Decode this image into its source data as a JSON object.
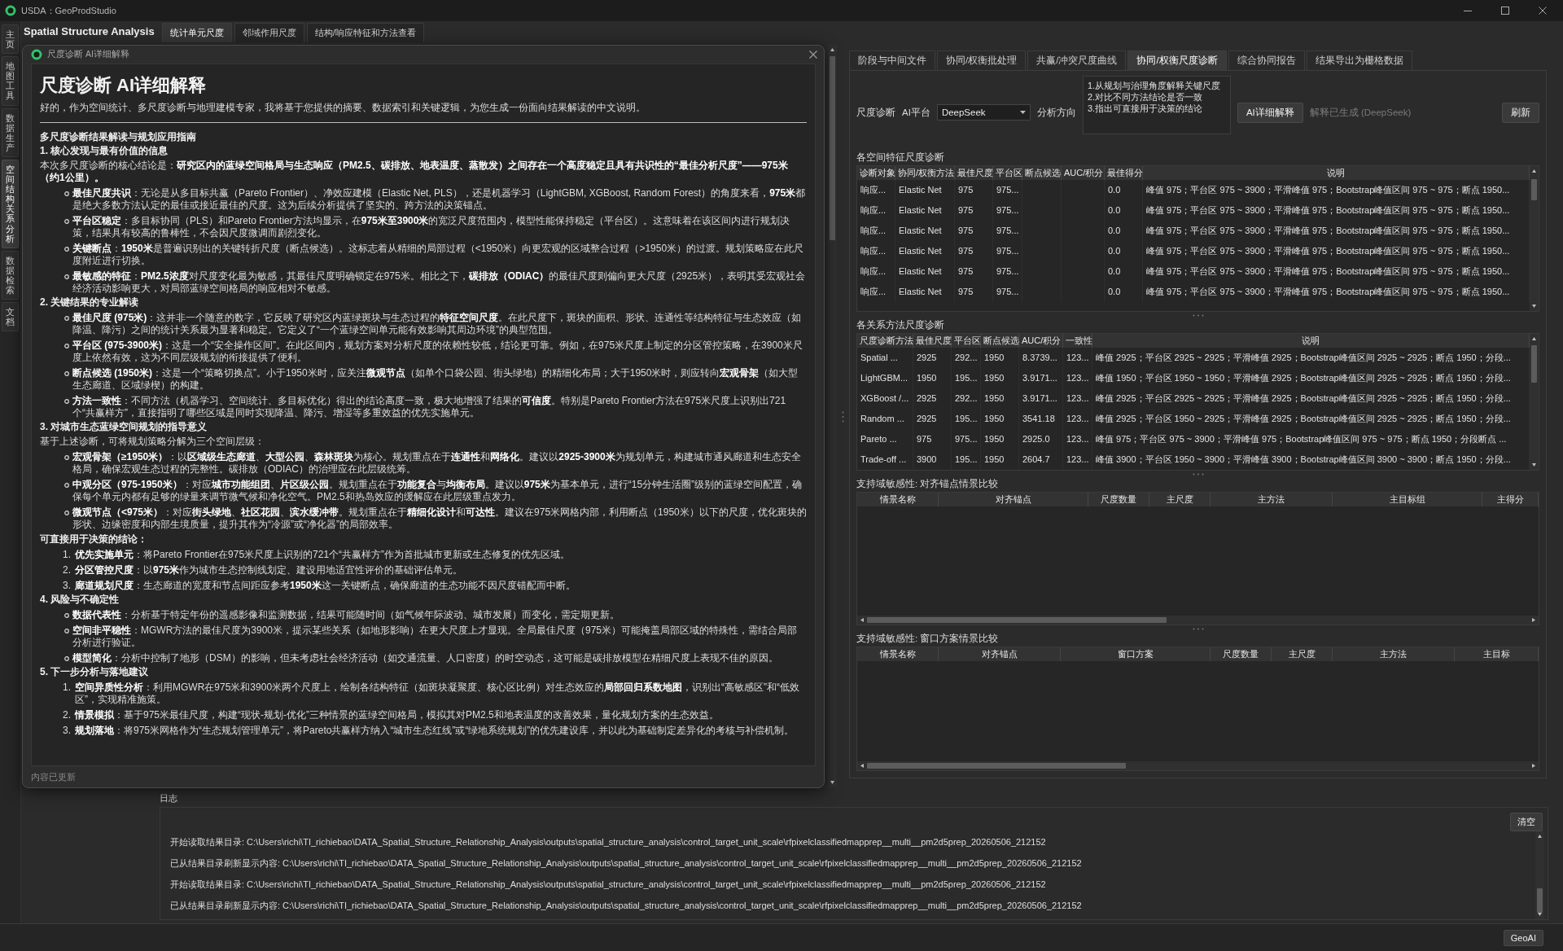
{
  "window": {
    "title": "USDA：GeoProdStudio"
  },
  "side_tabs": [
    {
      "label": "主页",
      "selected": false
    },
    {
      "label": "地图工具",
      "selected": false
    },
    {
      "label": "数据生产",
      "selected": false
    },
    {
      "label": "空间结构关系分析",
      "selected": true
    },
    {
      "label": "数据检索",
      "selected": false
    },
    {
      "label": "文档",
      "selected": false
    }
  ],
  "module": {
    "title": "Spatial Structure Analysis",
    "tabs": [
      {
        "label": "统计单元尺度",
        "selected": true
      },
      {
        "label": "邻域作用尺度",
        "selected": false
      },
      {
        "label": "结构/响应特征和方法查看",
        "selected": false
      }
    ]
  },
  "dialog": {
    "title": "尺度诊断 AI详细解释",
    "heading": "尺度诊断 AI详细解释",
    "intro": "好的，作为空间统计、多尺度诊断与地理建模专家，我将基于您提供的摘要、数据索引和关键逻辑，为您生成一份面向结果解读的中文说明。",
    "document": {
      "title": "多尺度诊断结果解读与规划应用指南",
      "sections": [
        {
          "heading": "1. 核心发现与最有价值的信息",
          "blocks": [
            {
              "kind": "paragraph",
              "text": "本次多尺度诊断的核心结论是：**研究区内的蓝绿空间格局与生态响应（PM2.5、碳排放、地表温度、蒸散发）之间存在一个高度稳定且具有共识性的“最佳分析尺度”——975米（约1公里）。**"
            },
            {
              "kind": "bullets",
              "items": [
                "**最佳尺度共识**：无论是从多目标共赢（Pareto Frontier）、净效应建模（Elastic Net, PLS），还是机器学习（LightGBM, XGBoost, Random Forest）的角度来看，**975米**都是绝大多数方法认定的最佳或接近最佳的尺度。这为后续分析提供了坚实的、跨方法的决策锚点。",
                "**平台区稳定**：多目标协同（PLS）和Pareto Frontier方法均显示，在**975米至3900米**的宽泛尺度范围内，模型性能保持稳定（平台区）。这意味着在该区间内进行规划决策，结果具有较高的鲁棒性，不会因尺度微调而剧烈变化。",
                "**关键断点**：**1950米**是普遍识别出的关键转折尺度（断点候选）。这标志着从精细的局部过程（<1950米）向更宏观的区域整合过程（>1950米）的过渡。规划策略应在此尺度附近进行切换。",
                "**最敏感的特征**：**PM2.5浓度**对尺度变化最为敏感，其最佳尺度明确锁定在975米。相比之下，**碳排放（ODIAC）**的最佳尺度则偏向更大尺度（2925米），表明其受宏观社会经济活动影响更大，对局部蓝绿空间格局的响应相对不敏感。"
              ]
            }
          ]
        },
        {
          "heading": "2. 关键结果的专业解读",
          "blocks": [
            {
              "kind": "bullets",
              "items": [
                "**最佳尺度 (975米)**：这并非一个随意的数字，它反映了研究区内蓝绿斑块与生态过程的**特征空间尺度**。在此尺度下，斑块的面积、形状、连通性等结构特征与生态效应（如降温、降污）之间的统计关系最为显著和稳定。它定义了“一个蓝绿空间单元能有效影响其周边环境”的典型范围。",
                "**平台区 (975-3900米)**：这是一个“安全操作区间”。在此区间内，规划方案对分析尺度的依赖性较低，结论更可靠。例如，在975米尺度上制定的分区管控策略，在3900米尺度上依然有效，这为不同层级规划的衔接提供了便利。",
                "**断点候选 (1950米)**：这是一个“策略切换点”。小于1950米时，应关注**微观节点**（如单个口袋公园、街头绿地）的精细化布局；大于1950米时，则应转向**宏观骨架**（如大型生态廊道、区域绿楔）的构建。",
                "**方法一致性**：不同方法（机器学习、空间统计、多目标优化）得出的结论高度一致，极大地增强了结果的**可信度**。特别是Pareto Frontier方法在975米尺度上识别出721个“共赢样方”，直接指明了哪些区域是同时实现降温、降污、增湿等多重效益的优先实施单元。"
              ]
            }
          ]
        },
        {
          "heading": "3. 对城市生态蓝绿空间规划的指导意义",
          "blocks": [
            {
              "kind": "paragraph",
              "text": "基于上述诊断，可将规划策略分解为三个空间层级："
            },
            {
              "kind": "bullets",
              "items": [
                "**宏观骨架（≥1950米）**：以**区域级生态廊道**、**大型公园**、**森林斑块**为核心。规划重点在于**连通性**和**网络化**。建议以**2925-3900米**为规划单元，构建城市通风廊道和生态安全格局，确保宏观生态过程的完整性。碳排放（ODIAC）的治理应在此层级统筹。",
                "**中观分区（975-1950米）**：对应**城市功能组团**、**片区级公园**。规划重点在于**功能复合**与**均衡布局**。建议以**975米**为基本单元，进行“15分钟生活圈”级别的蓝绿空间配置，确保每个单元内都有足够的绿量来调节微气候和净化空气。PM2.5和热岛效应的缓解应在此层级重点发力。",
                "**微观节点（<975米）**：对应**街头绿地**、**社区花园**、**滨水缓冲带**。规划重点在于**精细化设计**和**可达性**。建议在975米网格内部，利用断点（1950米）以下的尺度，优化斑块的形状、边缘密度和内部生境质量，提升其作为“冷源”或“净化器”的局部效率。"
              ]
            },
            {
              "kind": "subheading",
              "text": "可直接用于决策的结论："
            },
            {
              "kind": "numbered",
              "items": [
                {
                  "number": "1.",
                  "text": "**优先实施单元**：将Pareto Frontier在975米尺度上识别的721个“共赢样方”作为首批城市更新或生态修复的优先区域。"
                },
                {
                  "number": "2.",
                  "text": "**分区管控尺度**：以**975米**作为城市生态控制线划定、建设用地适宜性评价的基础评估单元。"
                },
                {
                  "number": "3.",
                  "text": "**廊道规划尺度**：生态廊道的宽度和节点间距应参考**1950米**这一关键断点，确保廊道的生态功能不因尺度错配而中断。"
                }
              ]
            }
          ]
        },
        {
          "heading": "4. 风险与不确定性",
          "blocks": [
            {
              "kind": "bullets",
              "items": [
                "**数据代表性**：分析基于特定年份的遥感影像和监测数据，结果可能随时间（如气候年际波动、城市发展）而变化，需定期更新。",
                "**空间非平稳性**：MGWR方法的最佳尺度为3900米，提示某些关系（如地形影响）在更大尺度上才显现。全局最佳尺度（975米）可能掩盖局部区域的特殊性，需结合局部分析进行验证。",
                "**模型简化**：分析中控制了地形（DSM）的影响，但未考虑社会经济活动（如交通流量、人口密度）的时空动态，这可能是碳排放模型在精细尺度上表现不佳的原因。"
              ]
            }
          ]
        },
        {
          "heading": "5. 下一步分析与落地建议",
          "blocks": [
            {
              "kind": "numbered",
              "items": [
                {
                  "number": "1.",
                  "text": "**空间异质性分析**：利用MGWR在975米和3900米两个尺度上，绘制各结构特征（如斑块凝聚度、核心区比例）对生态效应的**局部回归系数地图**，识别出“高敏感区”和“低效区”，实现精准施策。"
                },
                {
                  "number": "2.",
                  "text": "**情景模拟**：基于975米最佳尺度，构建“现状-规划-优化”三种情景的蓝绿空间格局，模拟其对PM2.5和地表温度的改善效果，量化规划方案的生态效益。"
                },
                {
                  "number": "3.",
                  "text": "**规划落地**：将975米网格作为“生态规划管理单元”，将Pareto共赢样方纳入“城市生态红线”或“绿地系统规划”的优先建设库，并以此为基础制定差异化的考核与补偿机制。"
                }
              ]
            }
          ]
        }
      ]
    },
    "footer": "内容已更新"
  },
  "right_panel": {
    "tabs": [
      {
        "label": "阶段与中间文件",
        "selected": false
      },
      {
        "label": "协同/权衡批处理",
        "selected": false
      },
      {
        "label": "共赢/冲突尺度曲线",
        "selected": false
      },
      {
        "label": "协同/权衡尺度诊断",
        "selected": true
      },
      {
        "label": "综合协同报告",
        "selected": false
      },
      {
        "label": "结果导出为栅格数据",
        "selected": false
      }
    ],
    "controls": {
      "label": "尺度诊断",
      "platform_label": "AI平台",
      "platform": "DeepSeek",
      "direction_label": "分析方向",
      "direction": "1.从规划与治理角度解释关键尺度\n2.对比不同方法结论是否一致\n3.指出可直接用于决策的结论",
      "explain_button": "AI详细解释",
      "status": "解释已生成 (DeepSeek)",
      "refresh_button": "刷新"
    },
    "tables": [
      {
        "title": "各空间特征尺度诊断",
        "columns": [
          "诊断对象",
          "协同/权衡方法",
          "最佳尺度",
          "平台区",
          "断点候选",
          "AUC/积分",
          "最佳得分",
          "说明"
        ],
        "rows": [
          {
            "target": "响应...",
            "method": "Elastic Net",
            "best_scale": "975",
            "plateau": "975...",
            "best_score": "0.0",
            "description": "峰值 975；平台区 975 ~ 3900；平滑峰值 975；Bootstrap峰值区间 975 ~ 975；断点 1950..."
          },
          {
            "target": "响应...",
            "method": "Elastic Net",
            "best_scale": "975",
            "plateau": "975...",
            "best_score": "0.0",
            "description": "峰值 975；平台区 975 ~ 3900；平滑峰值 975；Bootstrap峰值区间 975 ~ 975；断点 1950..."
          },
          {
            "target": "响应...",
            "method": "Elastic Net",
            "best_scale": "975",
            "plateau": "975...",
            "best_score": "0.0",
            "description": "峰值 975；平台区 975 ~ 3900；平滑峰值 975；Bootstrap峰值区间 975 ~ 975；断点 1950..."
          },
          {
            "target": "响应...",
            "method": "Elastic Net",
            "best_scale": "975",
            "plateau": "975...",
            "best_score": "0.0",
            "description": "峰值 975；平台区 975 ~ 3900；平滑峰值 975；Bootstrap峰值区间 975 ~ 975；断点 1950..."
          },
          {
            "target": "响应...",
            "method": "Elastic Net",
            "best_scale": "975",
            "plateau": "975...",
            "best_score": "0.0",
            "description": "峰值 975；平台区 975 ~ 3900；平滑峰值 975；Bootstrap峰值区间 975 ~ 975；断点 1950..."
          },
          {
            "target": "响应...",
            "method": "Elastic Net",
            "best_scale": "975",
            "plateau": "975...",
            "best_score": "0.0",
            "description": "峰值 975；平台区 975 ~ 3900；平滑峰值 975；Bootstrap峰值区间 975 ~ 975；断点 1950..."
          }
        ]
      },
      {
        "title": "各关系方法尺度诊断",
        "columns": [
          "尺度诊断方法",
          "最佳尺度",
          "平台区",
          "断点候选",
          "AUC/积分",
          "一致性",
          "说明"
        ],
        "rows": [
          {
            "method": "Spatial ...",
            "best_scale": "2925",
            "plateau": "292...",
            "breakpoint": "1950",
            "auc": "8.3739...",
            "consistency": "123...",
            "description": "峰值 2925；平台区 2925 ~ 2925；平滑峰值 2925；Bootstrap峰值区间 2925 ~ 2925；断点 1950；分段..."
          },
          {
            "method": "LightGBM...",
            "best_scale": "1950",
            "plateau": "195...",
            "breakpoint": "1950",
            "auc": "3.9171...",
            "consistency": "123...",
            "description": "峰值 1950；平台区 1950 ~ 1950；平滑峰值 2925；Bootstrap峰值区间 2925 ~ 2925；断点 1950；分段..."
          },
          {
            "method": "XGBoost /...",
            "best_scale": "2925",
            "plateau": "292...",
            "breakpoint": "1950",
            "auc": "3.9171...",
            "consistency": "123...",
            "description": "峰值 2925；平台区 2925 ~ 2925；平滑峰值 2925；Bootstrap峰值区间 2925 ~ 2925；断点 1950；分段..."
          },
          {
            "method": "Random ...",
            "best_scale": "2925",
            "plateau": "195...",
            "breakpoint": "1950",
            "auc": "3541.18",
            "consistency": "123...",
            "description": "峰值 2925；平台区 1950 ~ 2925；平滑峰值 2925；Bootstrap峰值区间 2925 ~ 2925；断点 1950；分段..."
          },
          {
            "method": "Pareto ...",
            "best_scale": "975",
            "plateau": "975...",
            "breakpoint": "1950",
            "auc": "2925.0",
            "consistency": "123...",
            "description": "峰值 975；平台区 975 ~ 3900；平滑峰值 975；Bootstrap峰值区间 975 ~ 975；断点 1950；分段断点 ..."
          },
          {
            "method": "Trade-off ...",
            "best_scale": "3900",
            "plateau": "195...",
            "breakpoint": "1950",
            "auc": "2604.7",
            "consistency": "123...",
            "description": "峰值 3900；平台区 1950 ~ 3900；平滑峰值 3900；Bootstrap峰值区间 3900 ~ 3900；断点 1950；分段..."
          }
        ]
      },
      {
        "title": "支持域敏感性: 对齐锚点情景比较",
        "columns": [
          "情景名称",
          "对齐锚点",
          "尺度数量",
          "主尺度",
          "主方法",
          "主目标组",
          "主得分"
        ]
      },
      {
        "title": "支持域敏感性: 窗口方案情景比较",
        "columns": [
          "情景名称",
          "对齐锚点",
          "窗口方案",
          "尺度数量",
          "主尺度",
          "主方法",
          "主目标"
        ]
      }
    ]
  },
  "log": {
    "title": "日志",
    "clear_button": "清空",
    "lines": [
      "开始读取结果目录: C:\\Users\\richi\\TI_richiebao\\DATA_Spatial_Structure_Relationship_Analysis\\outputs\\spatial_structure_analysis\\control_target_unit_scale\\rfpixelclassifiedmapprep__multi__pm2d5prep_20260506_212152",
      "已从结果目录刷新显示内容: C:\\Users\\richi\\TI_richiebao\\DATA_Spatial_Structure_Relationship_Analysis\\outputs\\spatial_structure_analysis\\control_target_unit_scale\\rfpixelclassifiedmapprep__multi__pm2d5prep_20260506_212152",
      "开始读取结果目录: C:\\Users\\richi\\TI_richiebao\\DATA_Spatial_Structure_Relationship_Analysis\\outputs\\spatial_structure_analysis\\control_target_unit_scale\\rfpixelclassifiedmapprep__multi__pm2d5prep_20260506_212152",
      "已从结果目录刷新显示内容: C:\\Users\\richi\\TI_richiebao\\DATA_Spatial_Structure_Relationship_Analysis\\outputs\\spatial_structure_analysis\\control_target_unit_scale\\rfpixelclassifiedmapprep__multi__pm2d5prep_20260506_212152"
    ]
  },
  "status_bar": {
    "button": "GeoAI"
  }
}
